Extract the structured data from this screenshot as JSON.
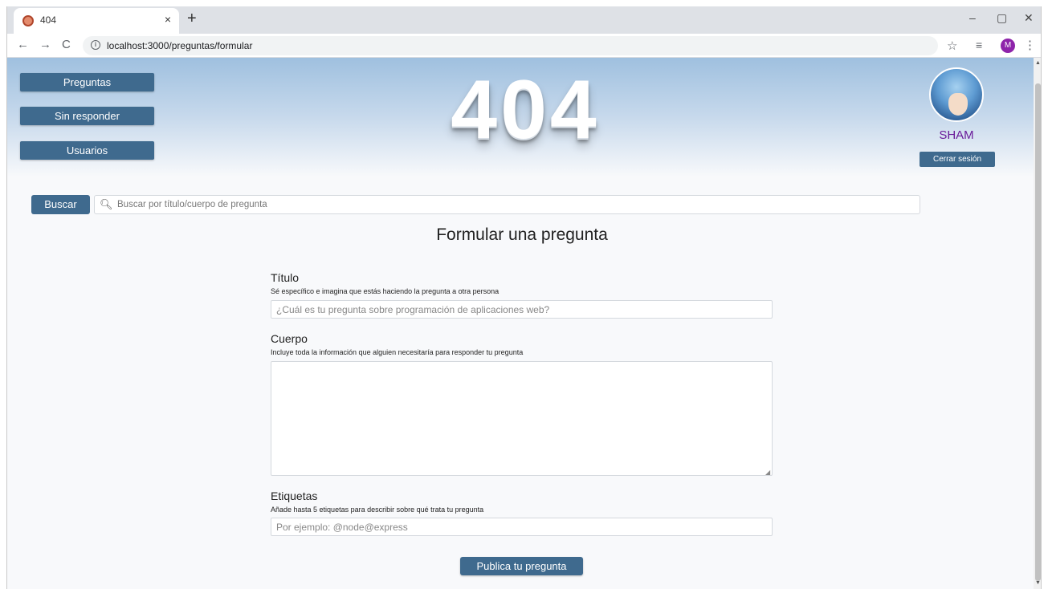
{
  "browser": {
    "tab_title": "404",
    "tab_close": "×",
    "new_tab": "+",
    "minimize": "–",
    "maximize": "▢",
    "close": "✕",
    "back": "←",
    "forward": "→",
    "reload": "C",
    "url": "localhost:3000/preguntas/formular",
    "bookmark_icon": "star-icon",
    "profile_initial": "M",
    "profile_color": "#8e24aa"
  },
  "nav": {
    "items": [
      {
        "label": "Preguntas"
      },
      {
        "label": "Sin responder"
      },
      {
        "label": "Usuarios"
      }
    ]
  },
  "logo": "404",
  "user": {
    "name": "SHAM",
    "logout_label": "Cerrar sesión"
  },
  "search": {
    "button_label": "Buscar",
    "placeholder": "Buscar por título/cuerpo de pregunta",
    "value": ""
  },
  "form": {
    "title": "Formular una pregunta",
    "titulo": {
      "label": "Título",
      "hint": "Sé específico e imagina que estás haciendo la pregunta a otra persona",
      "placeholder": "¿Cuál es tu pregunta sobre programación de aplicaciones web?",
      "value": ""
    },
    "cuerpo": {
      "label": "Cuerpo",
      "hint": "Incluye toda la información que alguien necesitaría para responder tu pregunta",
      "value": ""
    },
    "etiquetas": {
      "label": "Etiquetas",
      "hint": "Añade hasta 5 etiquetas para describir sobre qué trata tu pregunta",
      "placeholder": "Por ejemplo: @node@express",
      "value": ""
    },
    "submit_label": "Publica tu pregunta"
  },
  "colors": {
    "primary_button": "#3f6a8e",
    "username": "#6a1b9a",
    "header_gradient_top": "#9fc0df"
  }
}
